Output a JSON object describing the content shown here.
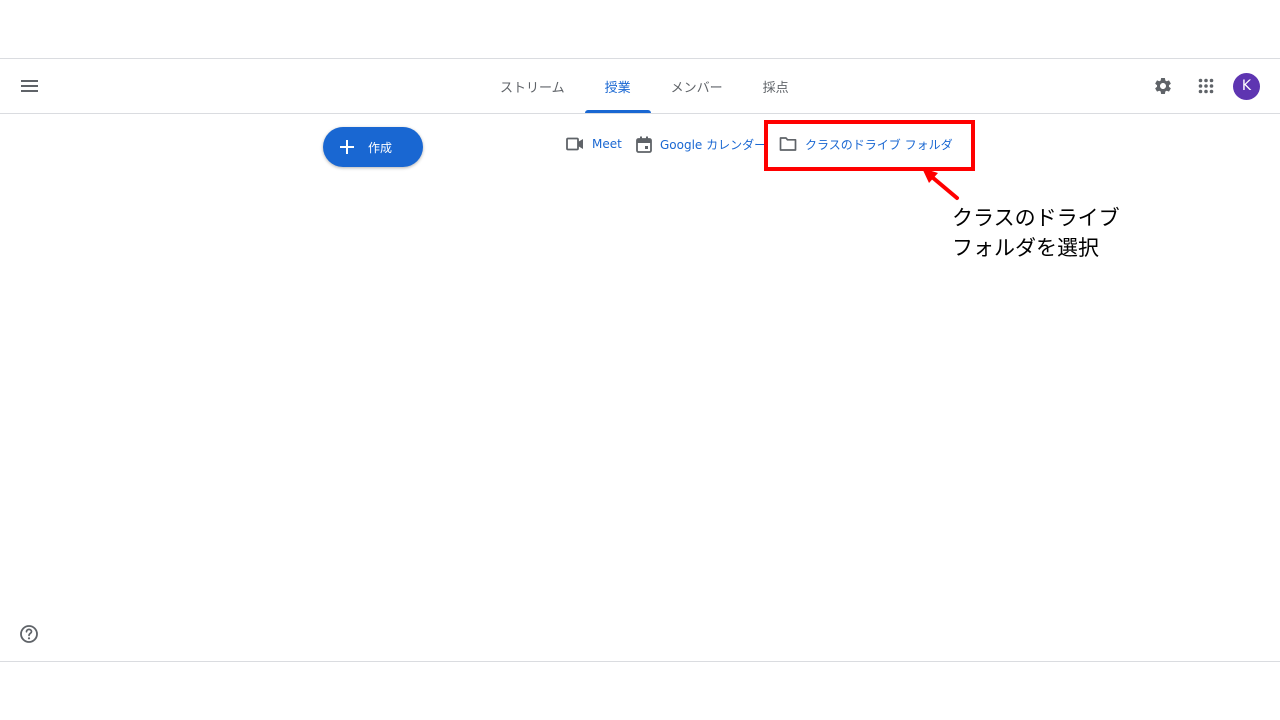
{
  "header": {
    "menu_icon": "hamburger-menu-icon",
    "tabs": [
      {
        "label": "ストリーム",
        "active": false
      },
      {
        "label": "授業",
        "active": true
      },
      {
        "label": "メンバー",
        "active": false
      },
      {
        "label": "採点",
        "active": false
      }
    ],
    "settings_icon": "gear-icon",
    "apps_icon": "apps-grid-icon",
    "avatar_initial": "K"
  },
  "toolbar": {
    "create_label": "作成",
    "meet_label": "Meet",
    "calendar_label": "Google カレンダー",
    "drive_label": "クラスのドライブ フォルダ"
  },
  "annotation": {
    "line1": "クラスのドライブ",
    "line2": "フォルダを選択"
  },
  "footer": {
    "help_icon": "help-circle-icon"
  },
  "colors": {
    "accent": "#1967d2",
    "highlight": "#ff0000",
    "avatar": "#5e35b1"
  }
}
